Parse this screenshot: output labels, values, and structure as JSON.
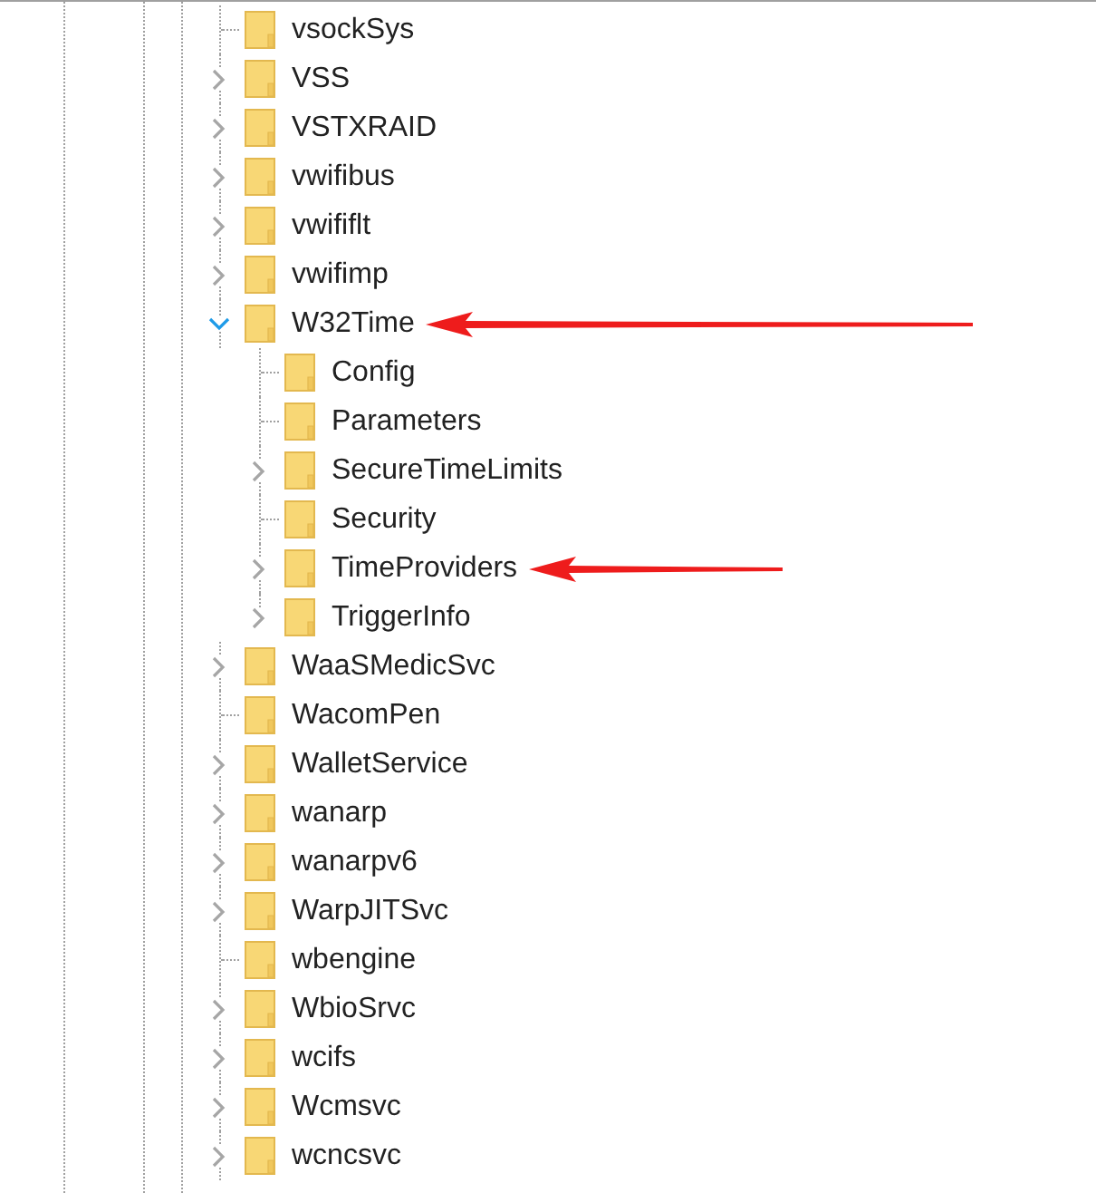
{
  "tree": {
    "items": [
      {
        "label": "vsockSys",
        "expandable": false,
        "arrow": false
      },
      {
        "label": "VSS",
        "expandable": true,
        "expanded": false,
        "arrow": false
      },
      {
        "label": "VSTXRAID",
        "expandable": true,
        "expanded": false,
        "arrow": false
      },
      {
        "label": "vwifibus",
        "expandable": true,
        "expanded": false,
        "arrow": false
      },
      {
        "label": "vwififlt",
        "expandable": true,
        "expanded": false,
        "arrow": false
      },
      {
        "label": "vwifimp",
        "expandable": true,
        "expanded": false,
        "arrow": false
      },
      {
        "label": "W32Time",
        "expandable": true,
        "expanded": true,
        "arrow": true,
        "children": [
          {
            "label": "Config",
            "expandable": false,
            "arrow": false
          },
          {
            "label": "Parameters",
            "expandable": false,
            "arrow": false
          },
          {
            "label": "SecureTimeLimits",
            "expandable": true,
            "expanded": false,
            "arrow": false
          },
          {
            "label": "Security",
            "expandable": false,
            "arrow": false
          },
          {
            "label": "TimeProviders",
            "expandable": true,
            "expanded": false,
            "arrow": true
          },
          {
            "label": "TriggerInfo",
            "expandable": true,
            "expanded": false,
            "arrow": false
          }
        ]
      },
      {
        "label": "WaaSMedicSvc",
        "expandable": true,
        "expanded": false,
        "arrow": false
      },
      {
        "label": "WacomPen",
        "expandable": false,
        "arrow": false
      },
      {
        "label": "WalletService",
        "expandable": true,
        "expanded": false,
        "arrow": false
      },
      {
        "label": "wanarp",
        "expandable": true,
        "expanded": false,
        "arrow": false
      },
      {
        "label": "wanarpv6",
        "expandable": true,
        "expanded": false,
        "arrow": false
      },
      {
        "label": "WarpJITSvc",
        "expandable": true,
        "expanded": false,
        "arrow": false
      },
      {
        "label": "wbengine",
        "expandable": false,
        "arrow": false
      },
      {
        "label": "WbioSrvc",
        "expandable": true,
        "expanded": false,
        "arrow": false
      },
      {
        "label": "wcifs",
        "expandable": true,
        "expanded": false,
        "arrow": false
      },
      {
        "label": "Wcmsvc",
        "expandable": true,
        "expanded": false,
        "arrow": false
      },
      {
        "label": "wcncsvc",
        "expandable": true,
        "expanded": false,
        "arrow": false
      }
    ]
  }
}
